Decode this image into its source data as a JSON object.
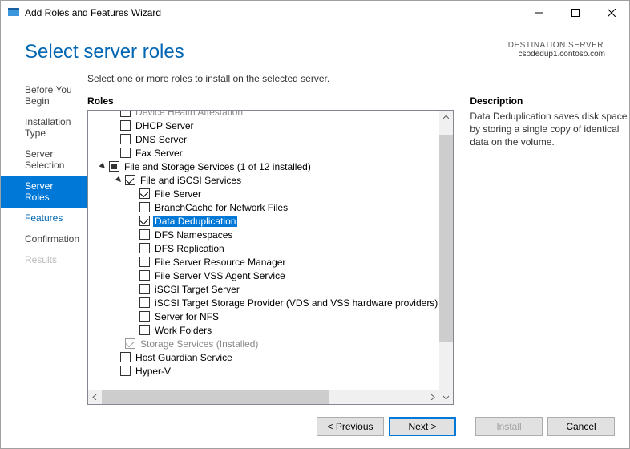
{
  "window": {
    "title": "Add Roles and Features Wizard"
  },
  "page_title": "Select server roles",
  "destination": {
    "label": "DESTINATION SERVER",
    "server": "csodedup1.contoso.com"
  },
  "sidebar": {
    "steps": [
      {
        "label": "Before You Begin"
      },
      {
        "label": "Installation Type"
      },
      {
        "label": "Server Selection"
      },
      {
        "label": "Server Roles"
      },
      {
        "label": "Features"
      },
      {
        "label": "Confirmation"
      },
      {
        "label": "Results"
      }
    ]
  },
  "instruction": "Select one or more roles to install on the selected server.",
  "roles_heading": "Roles",
  "description_heading": "Description",
  "description_text": "Data Deduplication saves disk space by storing a single copy of identical data on the volume.",
  "tree": {
    "device_health": "Device Health Attestation",
    "dhcp": "DHCP Server",
    "dns": "DNS Server",
    "fax": "Fax Server",
    "fss": "File and Storage Services (1 of 12 installed)",
    "fis": "File and iSCSI Services",
    "file_server": "File Server",
    "branchcache": "BranchCache for Network Files",
    "dedup": "Data Deduplication",
    "dfs_ns": "DFS Namespaces",
    "dfs_rep": "DFS Replication",
    "fsrm": "File Server Resource Manager",
    "vss": "File Server VSS Agent Service",
    "iscsi_target": "iSCSI Target Server",
    "iscsi_vds": "iSCSI Target Storage Provider (VDS and VSS hardware providers)",
    "nfs": "Server for NFS",
    "work_folders": "Work Folders",
    "storage_services": "Storage Services (Installed)",
    "host_guardian": "Host Guardian Service",
    "hyperv": "Hyper-V"
  },
  "buttons": {
    "previous": "< Previous",
    "next": "Next >",
    "install": "Install",
    "cancel": "Cancel"
  }
}
